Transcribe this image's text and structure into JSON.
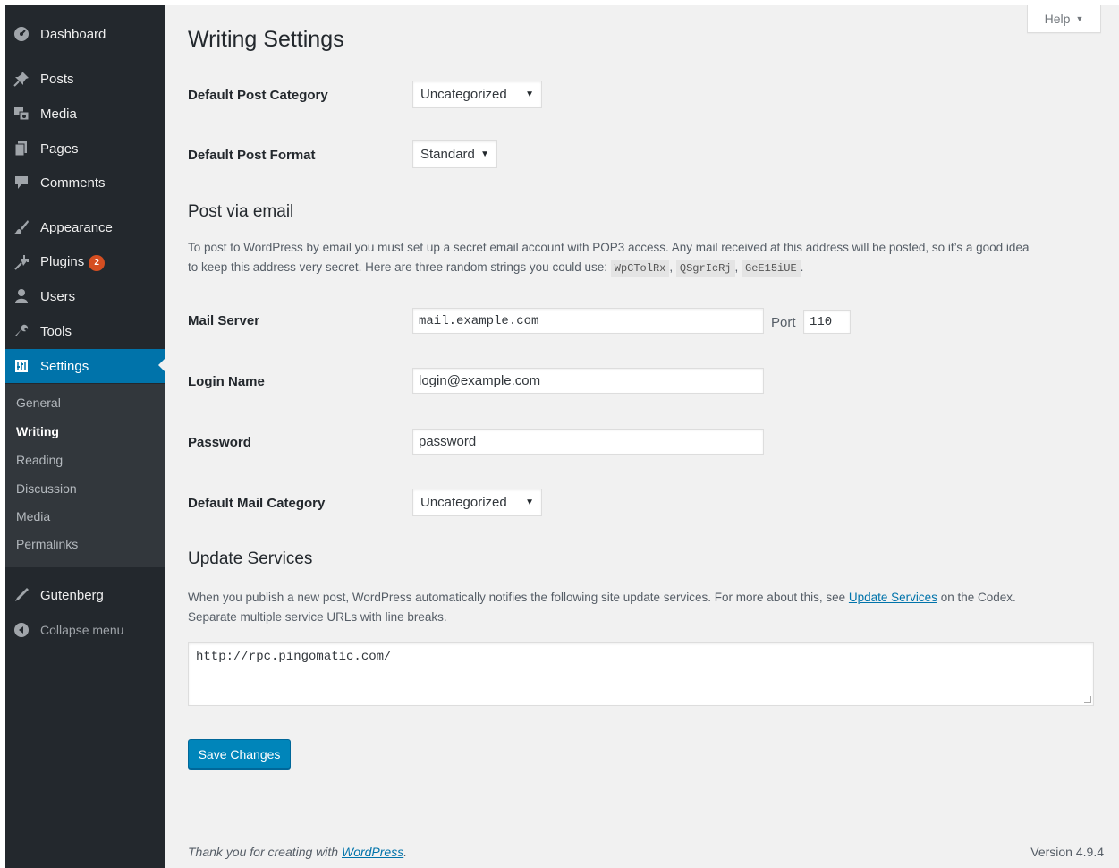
{
  "sidebar": {
    "items": [
      {
        "label": "Dashboard",
        "icon": "dashboard-icon"
      },
      {
        "label": "Posts",
        "icon": "pin-icon"
      },
      {
        "label": "Media",
        "icon": "media-icon"
      },
      {
        "label": "Pages",
        "icon": "pages-icon"
      },
      {
        "label": "Comments",
        "icon": "comment-icon"
      },
      {
        "label": "Appearance",
        "icon": "brush-icon"
      },
      {
        "label": "Plugins",
        "icon": "plugin-icon",
        "badge": "2"
      },
      {
        "label": "Users",
        "icon": "users-icon"
      },
      {
        "label": "Tools",
        "icon": "wrench-icon"
      },
      {
        "label": "Settings",
        "icon": "settings-icon",
        "active": true
      },
      {
        "label": "Gutenberg",
        "icon": "pen-icon"
      },
      {
        "label": "Collapse menu",
        "icon": "collapse-icon"
      }
    ],
    "submenu": [
      "General",
      "Writing",
      "Reading",
      "Discussion",
      "Media",
      "Permalinks"
    ],
    "current_submenu": "Writing"
  },
  "help": {
    "label": "Help",
    "arrow": "▼"
  },
  "page": {
    "title": "Writing Settings"
  },
  "fields": {
    "default_post_category": {
      "label": "Default Post Category",
      "value": "Uncategorized"
    },
    "default_post_format": {
      "label": "Default Post Format",
      "value": "Standard"
    },
    "mail_server": {
      "label": "Mail Server",
      "value": "mail.example.com",
      "port_label": "Port",
      "port_value": "110"
    },
    "login_name": {
      "label": "Login Name",
      "value": "login@example.com"
    },
    "password": {
      "label": "Password",
      "value": "password"
    },
    "default_mail_category": {
      "label": "Default Mail Category",
      "value": "Uncategorized"
    }
  },
  "post_via_email": {
    "title": "Post via email",
    "desc_line1": "To post to WordPress by email you must set up a secret email account with POP3 access. Any mail received at this address will be posted, so it’s a good idea",
    "desc_line2_prefix": "to keep this address very secret. Here are three random strings you could use:",
    "strings": [
      "WpCTolRx",
      "QSgrIcRj",
      "GeE15iUE"
    ],
    "sep": ",",
    "end": "."
  },
  "update_services": {
    "title": "Update Services",
    "desc_prefix": "When you publish a new post, WordPress automatically notifies the following site update services. For more about this, see",
    "link": "Update Services",
    "desc_suffix": "on the Codex.",
    "desc_line2": "Separate multiple service URLs with line breaks.",
    "urls": "http://rpc.pingomatic.com/"
  },
  "buttons": {
    "save": "Save Changes"
  },
  "footer": {
    "thanks_prefix": "Thank you for creating with",
    "link": "WordPress",
    "end": ".",
    "version": "Version 4.9.4"
  },
  "colors": {
    "sidebar": "#23282d",
    "submenu": "#32373c",
    "active": "#0073aa",
    "button": "#0085ba",
    "badge": "#d54e21",
    "background": "#f1f1f1"
  }
}
